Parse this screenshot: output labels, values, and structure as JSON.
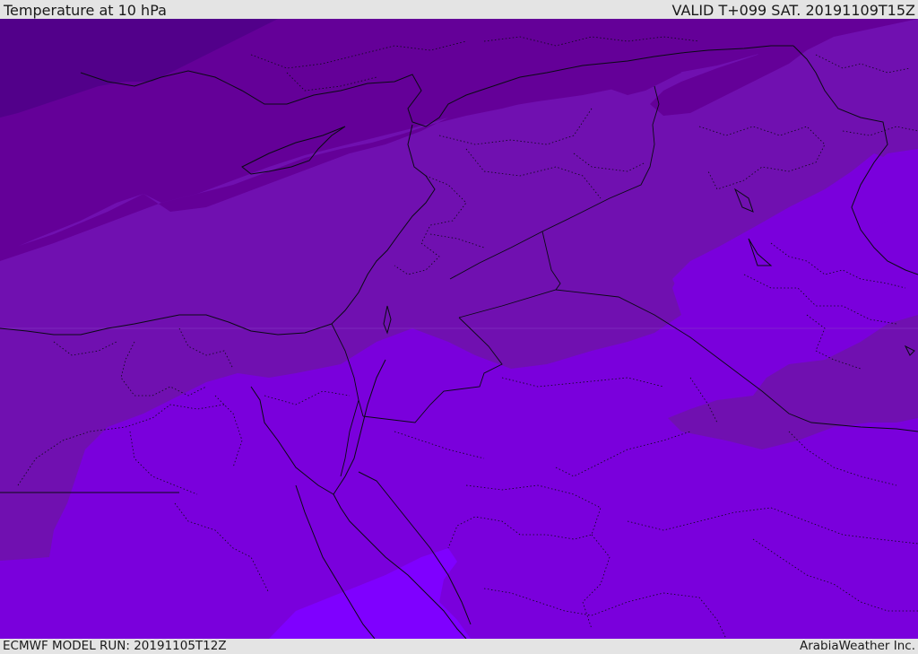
{
  "header": {
    "title": "Temperature at 10 hPa",
    "valid": "VALID T+099 SAT. 20191109T15Z"
  },
  "footer": {
    "model_run": "ECMWF MODEL RUN: 20191105T12Z",
    "credit": "ArabiaWeather Inc."
  },
  "colors": {
    "band_darkest": "#52008a",
    "band_dark": "#640098",
    "band_mid": "#7010b0",
    "band_violet": "#7a00dc",
    "band_bright": "#7f00ff",
    "border_line": "#0a0a14"
  }
}
